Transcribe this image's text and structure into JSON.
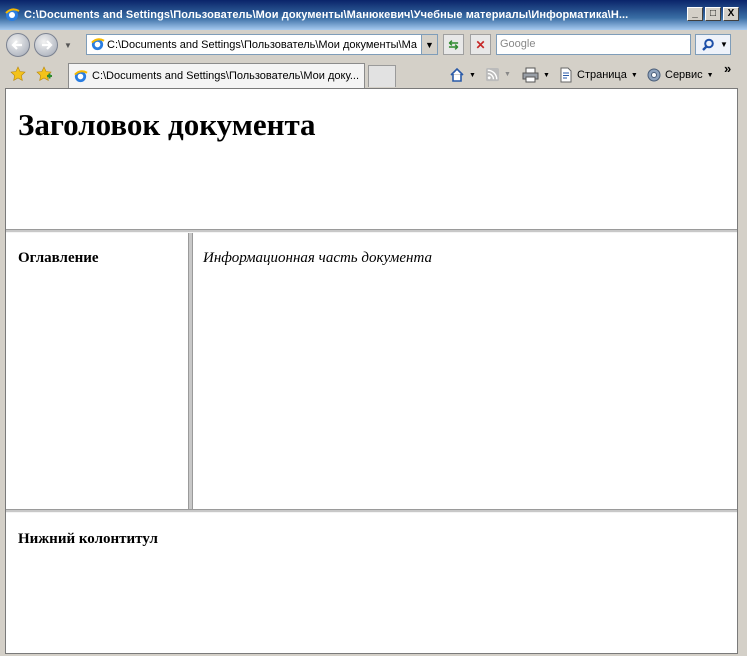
{
  "window": {
    "title": "C:\\Documents and Settings\\Пользователь\\Мои документы\\Манюкевич\\Учебные материалы\\Информатика\\Н...",
    "buttons": {
      "minimize": "_",
      "maximize": "□",
      "close": "X"
    }
  },
  "address_bar": {
    "value": "C:\\Documents and Settings\\Пользователь\\Мои документы\\Ман",
    "dropdown_icon": "chevron-down-icon"
  },
  "search": {
    "placeholder": "Google"
  },
  "tabs": [
    {
      "label": "C:\\Documents and Settings\\Пользователь\\Мои доку..."
    }
  ],
  "command_bar": {
    "page_label": "Страница",
    "tools_label": "Сервис",
    "overflow": "»"
  },
  "document": {
    "header_title": "Заголовок документа",
    "toc_title": "Оглавление",
    "main_text": "Информационная часть документа",
    "footer_title": "Нижний колонтитул"
  },
  "colors": {
    "titlebar": "#0a246a",
    "chrome": "#d4d0c8",
    "frame_border": "#9a9a9a"
  }
}
